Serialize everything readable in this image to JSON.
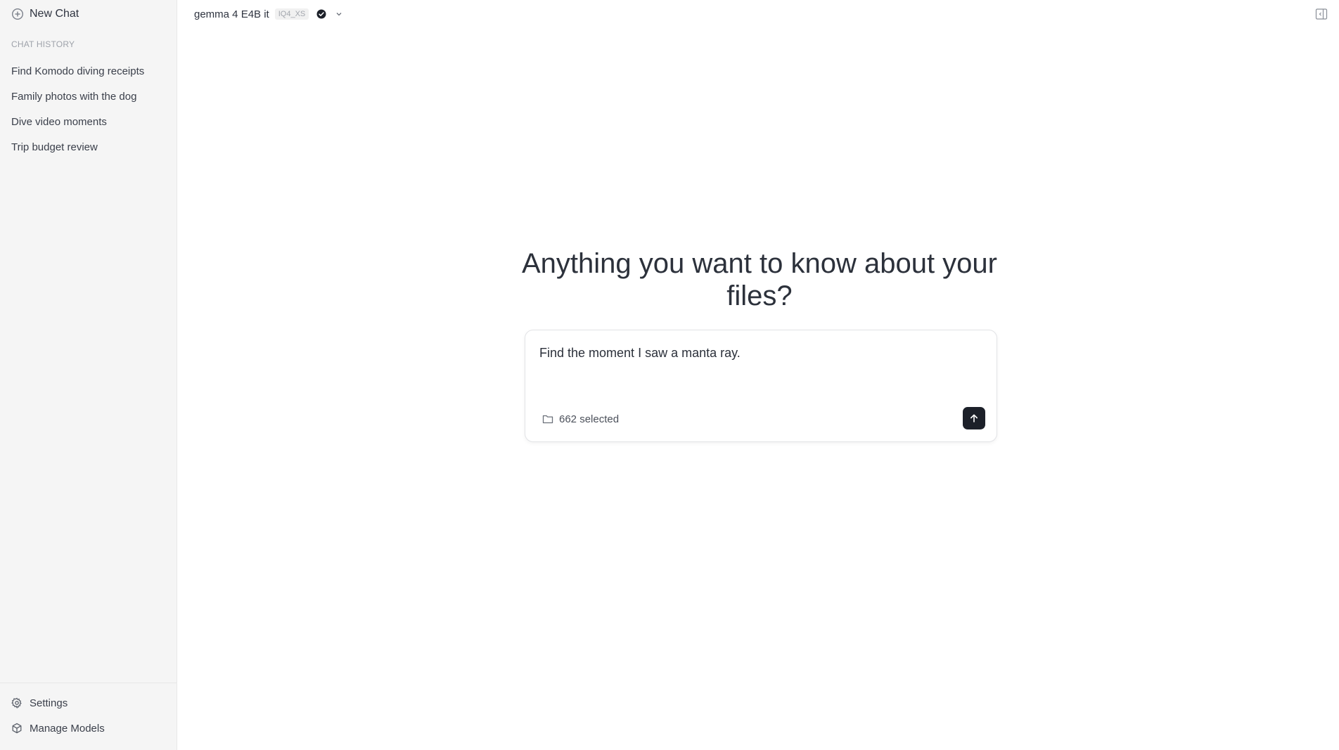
{
  "sidebar": {
    "new_chat_label": "New Chat",
    "history_heading": "CHAT HISTORY",
    "history": [
      {
        "label": "Find Komodo diving receipts"
      },
      {
        "label": "Family photos with the dog"
      },
      {
        "label": "Dive video moments"
      },
      {
        "label": "Trip budget review"
      }
    ],
    "footer": {
      "settings_label": "Settings",
      "manage_models_label": "Manage Models"
    }
  },
  "header": {
    "model_name": "gemma 4 E4B it",
    "model_quant": "IQ4_XS",
    "verified_icon": "check-badge-icon",
    "dropdown_icon": "chevron-down-icon",
    "panel_icon": "sidebar-toggle-icon"
  },
  "main": {
    "title": "Anything you want to know about your files?",
    "composer": {
      "input_value": "Find the moment I saw a manta ray.",
      "file_count_label": "662 selected",
      "folder_icon": "folder-icon",
      "send_icon": "arrow-up-icon"
    }
  },
  "colors": {
    "sidebar_bg": "#f5f5f5",
    "accent_dark": "#1c2029",
    "muted_text": "#9ea2aa"
  }
}
